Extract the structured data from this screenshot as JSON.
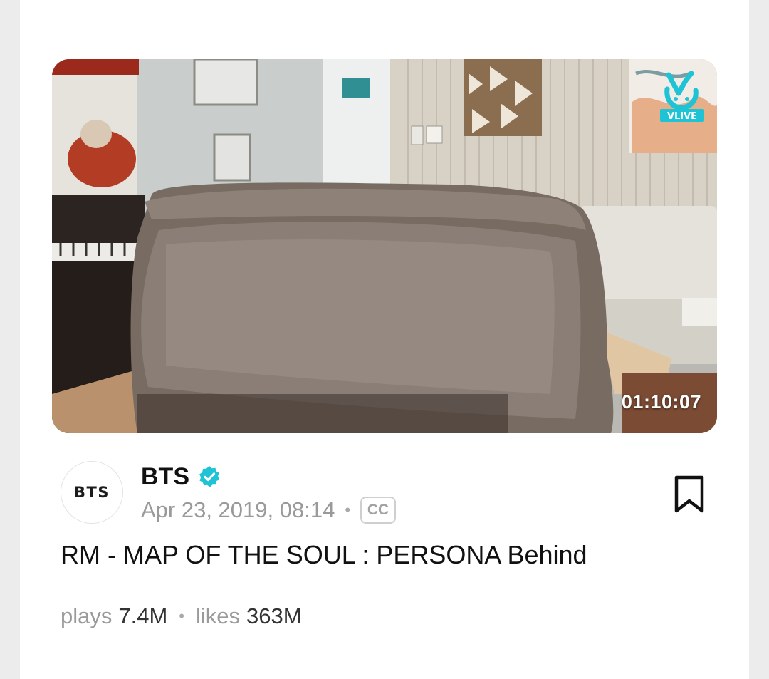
{
  "video": {
    "duration": "01:10:07",
    "badge_label": "VLIVE",
    "title": "RM - MAP OF THE SOUL : PERSONA Behind"
  },
  "channel": {
    "avatar_text": "BTS",
    "name": "BTS",
    "verified": true,
    "date": "Apr 23, 2019, 08:14",
    "cc_label": "CC"
  },
  "stats": {
    "plays_label": "plays",
    "plays_value": "7.4M",
    "likes_label": "likes",
    "likes_value": "363M"
  },
  "colors": {
    "accent": "#1fc3d6",
    "text_primary": "#111111",
    "text_secondary": "#9a9a9a"
  },
  "icons": {
    "verified": "verified-check-icon",
    "bookmark": "bookmark-icon",
    "vlive": "vlive-logo-icon"
  }
}
